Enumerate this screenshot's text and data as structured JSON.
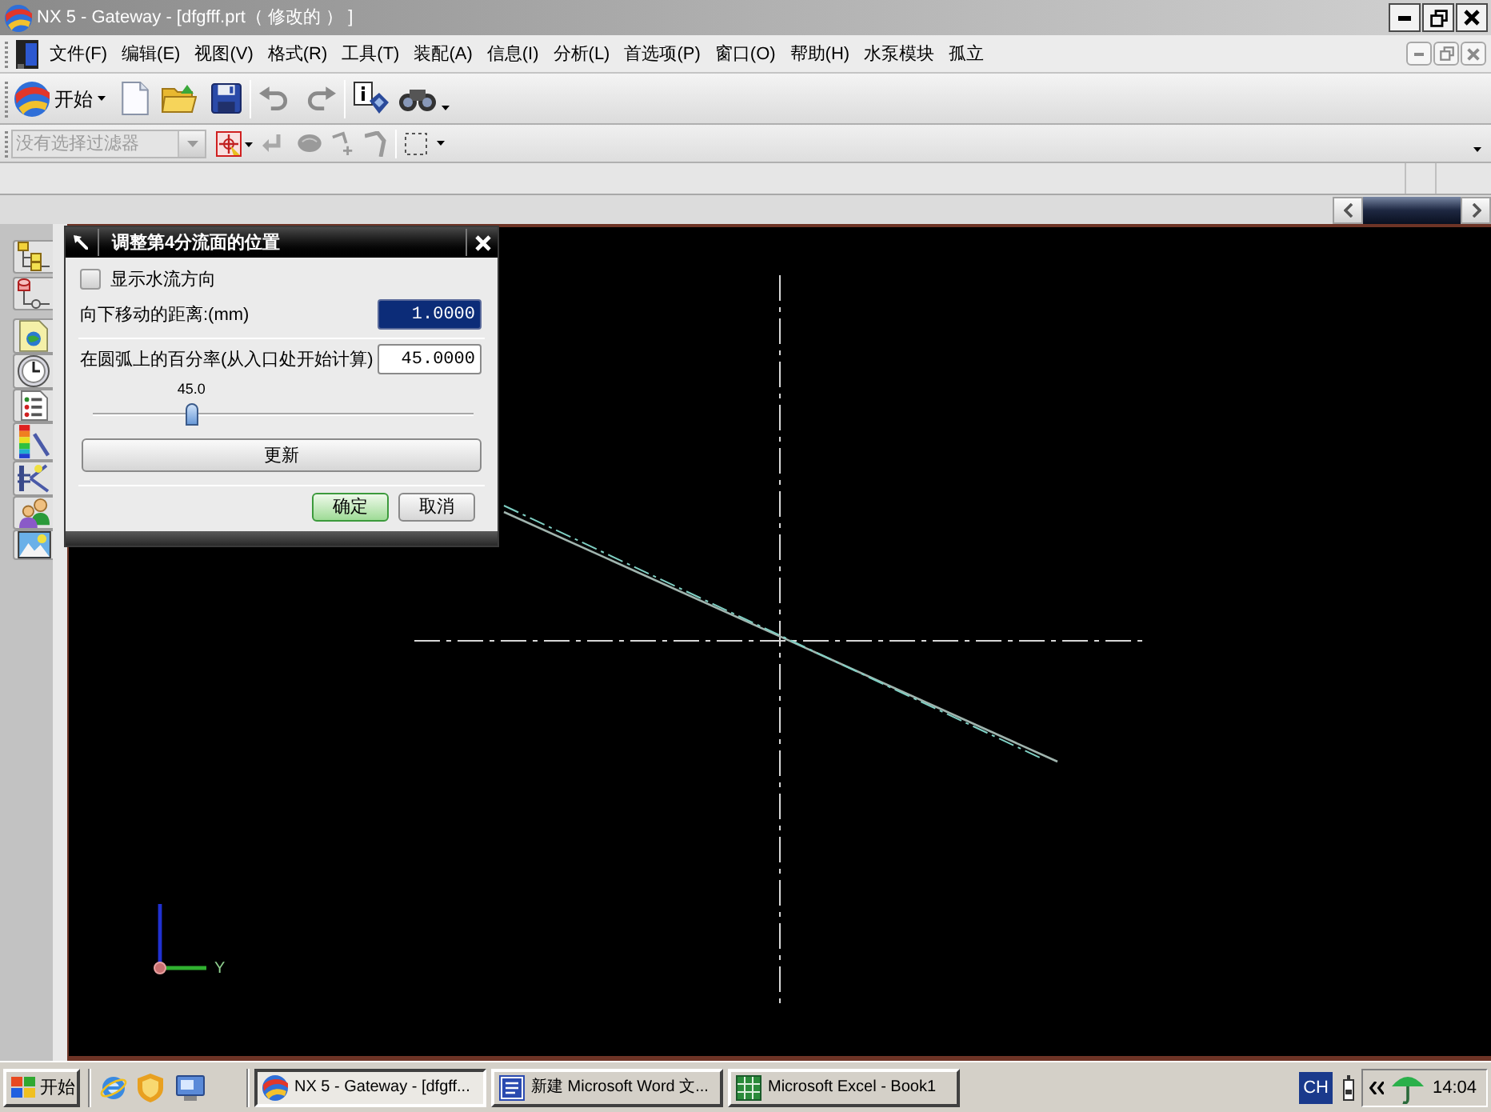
{
  "window": {
    "title": "NX 5 - Gateway - [dfgfff.prt（ 修改的 ） ]"
  },
  "menu_bar": {
    "items": [
      "文件(F)",
      "编辑(E)",
      "视图(V)",
      "格式(R)",
      "工具(T)",
      "装配(A)",
      "信息(I)",
      "分析(L)",
      "首选项(P)",
      "窗口(O)",
      "帮助(H)",
      "水泵模块",
      "孤立"
    ]
  },
  "standard_toolbar": {
    "start_label": "开始"
  },
  "selection_bar": {
    "filter": {
      "value": "没有选择过滤器",
      "disabled": true
    }
  },
  "dialog": {
    "title": "调整第4分流面的位置",
    "checkbox": {
      "label": "显示水流方向",
      "checked": false
    },
    "fields": [
      {
        "label": "向下移动的距离:(mm)",
        "value": "1.0000",
        "selected": true
      },
      {
        "label": "在圆弧上的百分率(从入口处开始计算)",
        "value": "45.0000",
        "selected": false
      }
    ],
    "slider": {
      "reading": "45.0",
      "level": 0.26
    },
    "update_button": "更新",
    "buttons": [
      {
        "label": "确定",
        "kind": "default"
      },
      {
        "label": "取消",
        "kind": "normal"
      }
    ]
  },
  "viewport": {
    "axis_label": "Y"
  },
  "taskbar": {
    "start_label": "开始",
    "tasks": [
      {
        "label": "NX 5 - Gateway - [dfgff...",
        "selected": true
      },
      {
        "label": "新建 Microsoft Word 文...",
        "selected": false
      },
      {
        "label": "Microsoft Excel - Book1",
        "selected": false
      }
    ],
    "language": "CH",
    "clock": "14:04"
  }
}
